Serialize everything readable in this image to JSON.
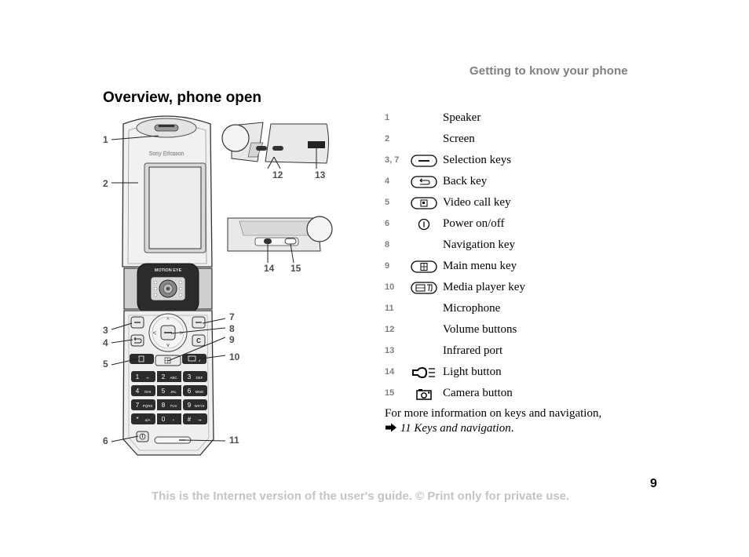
{
  "header": {
    "section_title": "Getting to know your phone"
  },
  "page_title": "Overview, phone open",
  "keys": [
    {
      "num": "1",
      "icon": "",
      "label": "Speaker"
    },
    {
      "num": "2",
      "icon": "",
      "label": "Screen"
    },
    {
      "num": "3, 7",
      "icon": "selection-key-icon",
      "label": "Selection keys"
    },
    {
      "num": "4",
      "icon": "back-key-icon",
      "label": "Back key"
    },
    {
      "num": "5",
      "icon": "video-call-key-icon",
      "label": "Video call key"
    },
    {
      "num": "6",
      "icon": "power-icon",
      "label": "Power on/off"
    },
    {
      "num": "8",
      "icon": "",
      "label": "Navigation key"
    },
    {
      "num": "9",
      "icon": "main-menu-key-icon",
      "label": "Main menu key"
    },
    {
      "num": "10",
      "icon": "media-player-key-icon",
      "label": "Media player key"
    },
    {
      "num": "11",
      "icon": "",
      "label": "Microphone"
    },
    {
      "num": "12",
      "icon": "",
      "label": "Volume buttons"
    },
    {
      "num": "13",
      "icon": "",
      "label": "Infrared port"
    },
    {
      "num": "14",
      "icon": "light-button-icon",
      "label": "Light button"
    },
    {
      "num": "15",
      "icon": "camera-button-icon",
      "label": "Camera button"
    }
  ],
  "more_info": {
    "text": "For more information on keys and navigation,",
    "arrow_icon": "arrow-right-icon",
    "reference": "11 Keys and navigation",
    "suffix": "."
  },
  "diagram": {
    "brand_text": "Sony Ericsson",
    "camera_label": "MOTION EYE",
    "callouts": [
      "1",
      "2",
      "3",
      "4",
      "5",
      "6",
      "7",
      "8",
      "9",
      "10",
      "11",
      "12",
      "13",
      "14",
      "15"
    ],
    "keypad": [
      [
        "1",
        "∞"
      ],
      [
        "2",
        "ABC"
      ],
      [
        "3",
        "DEF"
      ],
      [
        "4",
        "GHI"
      ],
      [
        "5",
        "JKL"
      ],
      [
        "6",
        "MNO"
      ],
      [
        "7",
        "PQRS"
      ],
      [
        "8",
        "TUV"
      ],
      [
        "9",
        "WXYZ"
      ],
      [
        "*",
        "a/A"
      ],
      [
        "0",
        "+"
      ],
      [
        "#",
        "-↠"
      ]
    ]
  },
  "footer": {
    "page_number": "9",
    "note": "This is the Internet version of the user's guide. © Print only for private use."
  }
}
